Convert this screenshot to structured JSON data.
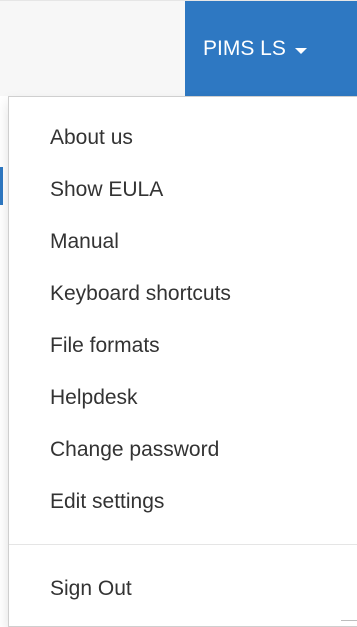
{
  "navbar": {
    "user_menu_label": "PIMS LS",
    "brand_color": "#2e78c2"
  },
  "dropdown": {
    "items": [
      {
        "label": "About us"
      },
      {
        "label": "Show EULA"
      },
      {
        "label": "Manual"
      },
      {
        "label": "Keyboard shortcuts"
      },
      {
        "label": "File formats"
      },
      {
        "label": "Helpdesk"
      },
      {
        "label": "Change password"
      },
      {
        "label": "Edit settings"
      }
    ],
    "sign_out_label": "Sign Out"
  }
}
